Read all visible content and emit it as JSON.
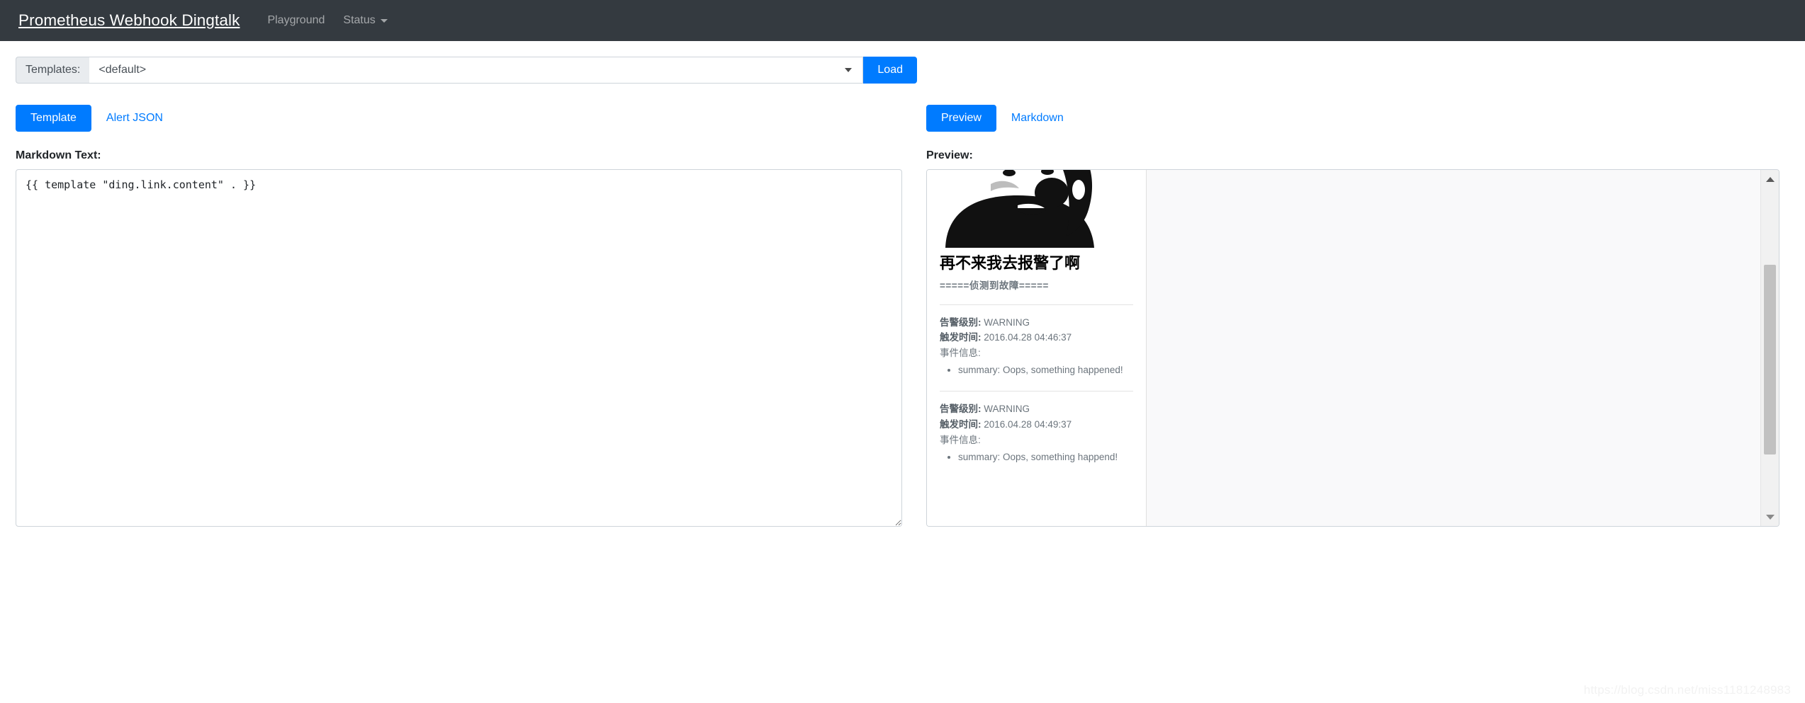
{
  "navbar": {
    "brand": "Prometheus Webhook Dingtalk",
    "links": [
      {
        "label": "Playground"
      },
      {
        "label": "Status",
        "has_caret": true
      }
    ]
  },
  "templates_bar": {
    "prepend_label": "Templates:",
    "selected_option": "<default>",
    "options": [
      "<default>"
    ],
    "load_button": "Load"
  },
  "left_panel": {
    "tabs": [
      {
        "label": "Template",
        "active": true
      },
      {
        "label": "Alert JSON",
        "active": false
      }
    ],
    "editor_label": "Markdown Text:",
    "editor_value": "{{ template \"ding.link.content\" . }}",
    "editor_placeholder": ""
  },
  "right_panel": {
    "tabs": [
      {
        "label": "Preview",
        "active": true
      },
      {
        "label": "Markdown",
        "active": false
      }
    ],
    "preview_label": "Preview:",
    "card": {
      "image_alt": "panda-meme-phone",
      "heading": "再不来我去报警了啊",
      "subheading": "=====侦测到故障=====",
      "alerts": [
        {
          "severity_label": "告警级别:",
          "severity_value": "WARNING",
          "time_label": "触发时间:",
          "time_value": "2016.04.28 04:46:37",
          "info_label": "事件信息:",
          "items": [
            "summary: Oops, something happened!"
          ]
        },
        {
          "severity_label": "告警级别:",
          "severity_value": "WARNING",
          "time_label": "触发时间:",
          "time_value": "2016.04.28 04:49:37",
          "info_label": "事件信息:",
          "items": [
            "summary: Oops, something happend!"
          ]
        }
      ]
    }
  },
  "watermark": "https://blog.csdn.net/miss1181248983",
  "colors": {
    "navbar_bg": "#343a40",
    "primary": "#007bff",
    "border": "#ced4da",
    "prepend_bg": "#e9ecef",
    "preview_bg": "#f9f9fa",
    "muted_text": "#6c757d"
  }
}
